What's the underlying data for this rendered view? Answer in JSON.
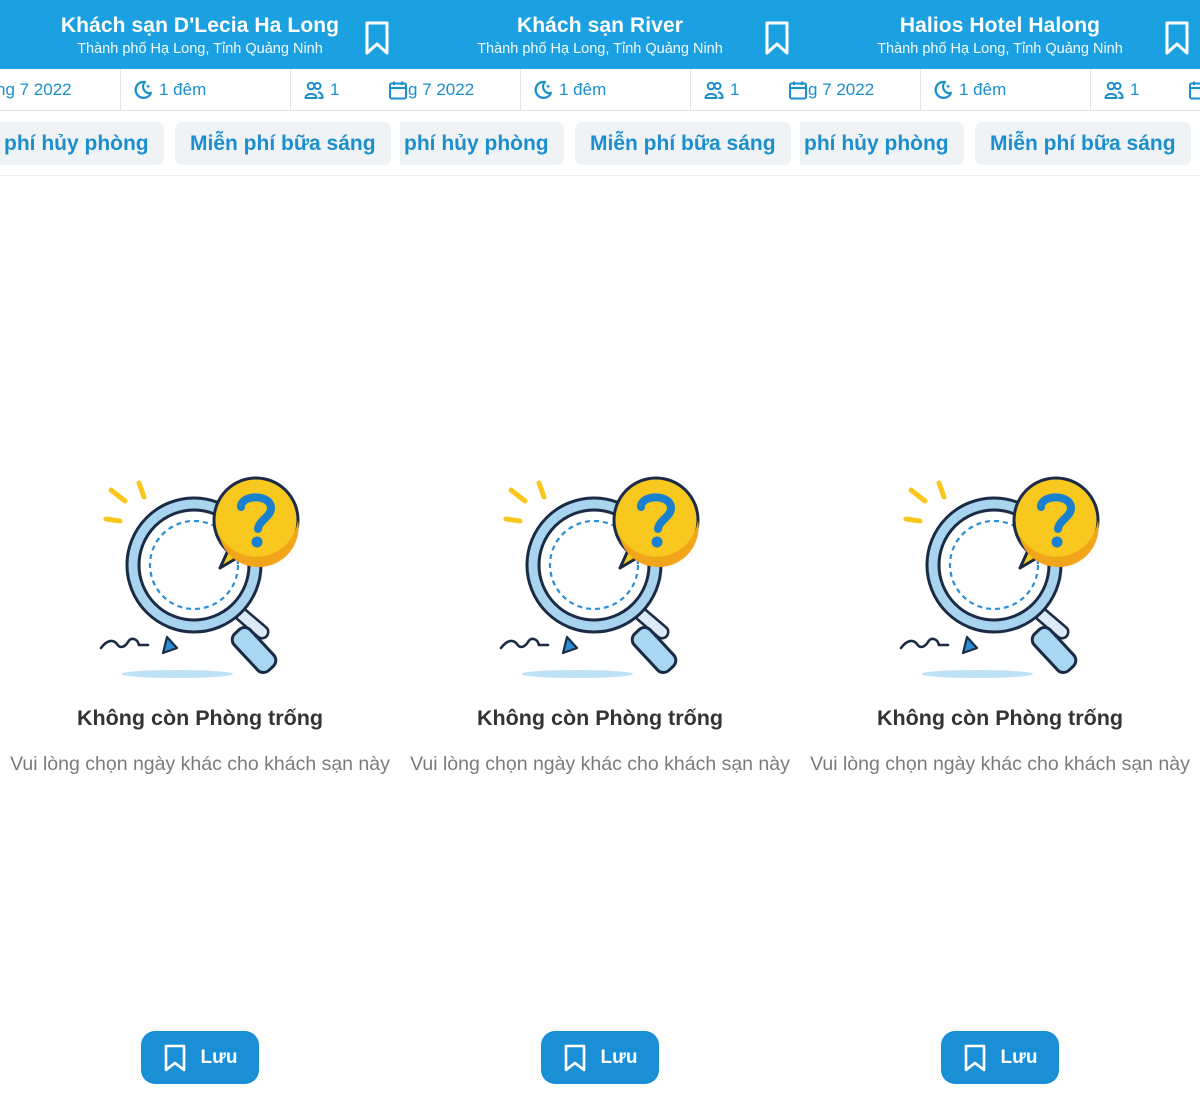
{
  "panels": [
    {
      "header": {
        "title": "Khách sạn D'Lecia Ha Long",
        "location": "Thành phố Hạ Long, Tỉnh Quảng Ninh"
      },
      "search": {
        "date": "ng 7 2022",
        "nights": "1 đêm",
        "guests": "1"
      },
      "filters": [
        "phí hủy phòng",
        "Miễn phí bữa sáng"
      ],
      "empty": {
        "title": "Không còn Phòng trống",
        "message": "Vui lòng chọn ngày khác cho khách sạn này"
      },
      "save_label": "Lưu"
    },
    {
      "header": {
        "title": "Khách sạn River",
        "location": "Thành phố Hạ Long, Tỉnh Quảng Ninh"
      },
      "search": {
        "date": "g 7 2022",
        "nights": "1 đêm",
        "guests": "1"
      },
      "filters": [
        "phí hủy phòng",
        "Miễn phí bữa sáng"
      ],
      "empty": {
        "title": "Không còn Phòng trống",
        "message": "Vui lòng chọn ngày khác cho khách sạn này"
      },
      "save_label": "Lưu"
    },
    {
      "header": {
        "title": "Halios Hotel Halong",
        "location": "Thành phố Hạ Long, Tỉnh Quảng Ninh"
      },
      "search": {
        "date": "g 7 2022",
        "nights": "1 đêm",
        "guests": "1"
      },
      "filters": [
        "phí hủy phòng",
        "Miễn phí bữa sáng"
      ],
      "empty": {
        "title": "Không còn Phòng trống",
        "message": "Vui lòng chọn ngày khác cho khách sạn này"
      },
      "save_label": "Lưu"
    }
  ],
  "icons": {
    "header_action": "bookmark-icon",
    "date": "calendar-icon",
    "nights": "moon-icon",
    "guests": "people-icon",
    "empty_state": "magnifier-question-illustration",
    "save": "bookmark-icon"
  },
  "colors": {
    "header_bg": "#1ba0e2",
    "accent": "#1b8fce",
    "chip_bg": "#f0f3f5",
    "save_button": "#1a8fd6",
    "empty_title": "#333333",
    "empty_message": "#7b7b7b"
  }
}
